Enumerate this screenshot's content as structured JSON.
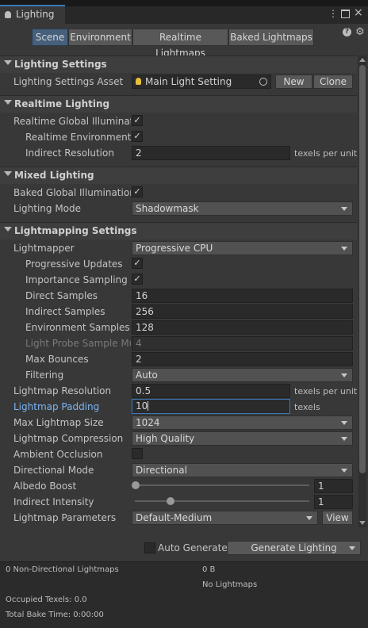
{
  "window": {
    "title": "Lighting"
  },
  "tabs": [
    {
      "label": "Scene",
      "selected": true
    },
    {
      "label": "Environment",
      "selected": false
    },
    {
      "label": "Realtime Lightmaps",
      "selected": false
    },
    {
      "label": "Baked Lightmaps",
      "selected": false
    }
  ],
  "sections": {
    "lighting_settings": "Lighting Settings",
    "realtime_lighting": "Realtime Lighting",
    "mixed_lighting": "Mixed Lighting",
    "lightmapping_settings": "Lightmapping Settings"
  },
  "lighting_settings": {
    "asset_label": "Lighting Settings Asset",
    "asset_value": "Main Light Setting",
    "new_button": "New",
    "clone_button": "Clone"
  },
  "realtime": {
    "gi_label": "Realtime Global Illuminatio",
    "gi_checked": true,
    "env_label": "Realtime Environment L",
    "env_checked": true,
    "indirect_res_label": "Indirect Resolution",
    "indirect_res_value": "2",
    "indirect_res_unit": "texels per unit"
  },
  "mixed": {
    "baked_gi_label": "Baked Global Illumination",
    "baked_gi_checked": true,
    "mode_label": "Lighting Mode",
    "mode_value": "Shadowmask"
  },
  "lightmapping": {
    "lightmapper_label": "Lightmapper",
    "lightmapper_value": "Progressive CPU",
    "prog_updates_label": "Progressive Updates",
    "prog_updates_checked": true,
    "importance_label": "Importance Sampling",
    "importance_checked": true,
    "direct_label": "Direct Samples",
    "direct_value": "16",
    "indirect_label": "Indirect Samples",
    "indirect_value": "256",
    "env_samples_label": "Environment Samples",
    "env_samples_value": "128",
    "probe_label": "Light Probe Sample Mul",
    "probe_value": "4",
    "bounces_label": "Max Bounces",
    "bounces_value": "2",
    "filtering_label": "Filtering",
    "filtering_value": "Auto",
    "resolution_label": "Lightmap Resolution",
    "resolution_value": "0.5",
    "resolution_unit": "texels per unit",
    "padding_label": "Lightmap Padding",
    "padding_value": "10",
    "padding_unit": "texels",
    "max_size_label": "Max Lightmap Size",
    "max_size_value": "1024",
    "compression_label": "Lightmap Compression",
    "compression_value": "High Quality",
    "ao_label": "Ambient Occlusion",
    "ao_checked": false,
    "directional_label": "Directional Mode",
    "directional_value": "Directional",
    "albedo_label": "Albedo Boost",
    "albedo_value": "1",
    "albedo_fraction": 0.0,
    "intensity_label": "Indirect Intensity",
    "intensity_value": "1",
    "intensity_fraction": 0.2,
    "params_label": "Lightmap Parameters",
    "params_value": "Default-Medium",
    "view_button": "View"
  },
  "generate": {
    "auto_label": "Auto Generate",
    "auto_checked": false,
    "generate_button": "Generate Lighting"
  },
  "stats": {
    "lightmaps": "0 Non-Directional Lightmaps",
    "size": "0 B",
    "no_lightmaps": "No Lightmaps",
    "occupied": "Occupied Texels: 0.0",
    "bake_time": "Total Bake Time: 0:00:00"
  },
  "colors": {
    "accent": "#3a79bb",
    "highlight_label": "#7ab4f5",
    "background": "#383838"
  }
}
